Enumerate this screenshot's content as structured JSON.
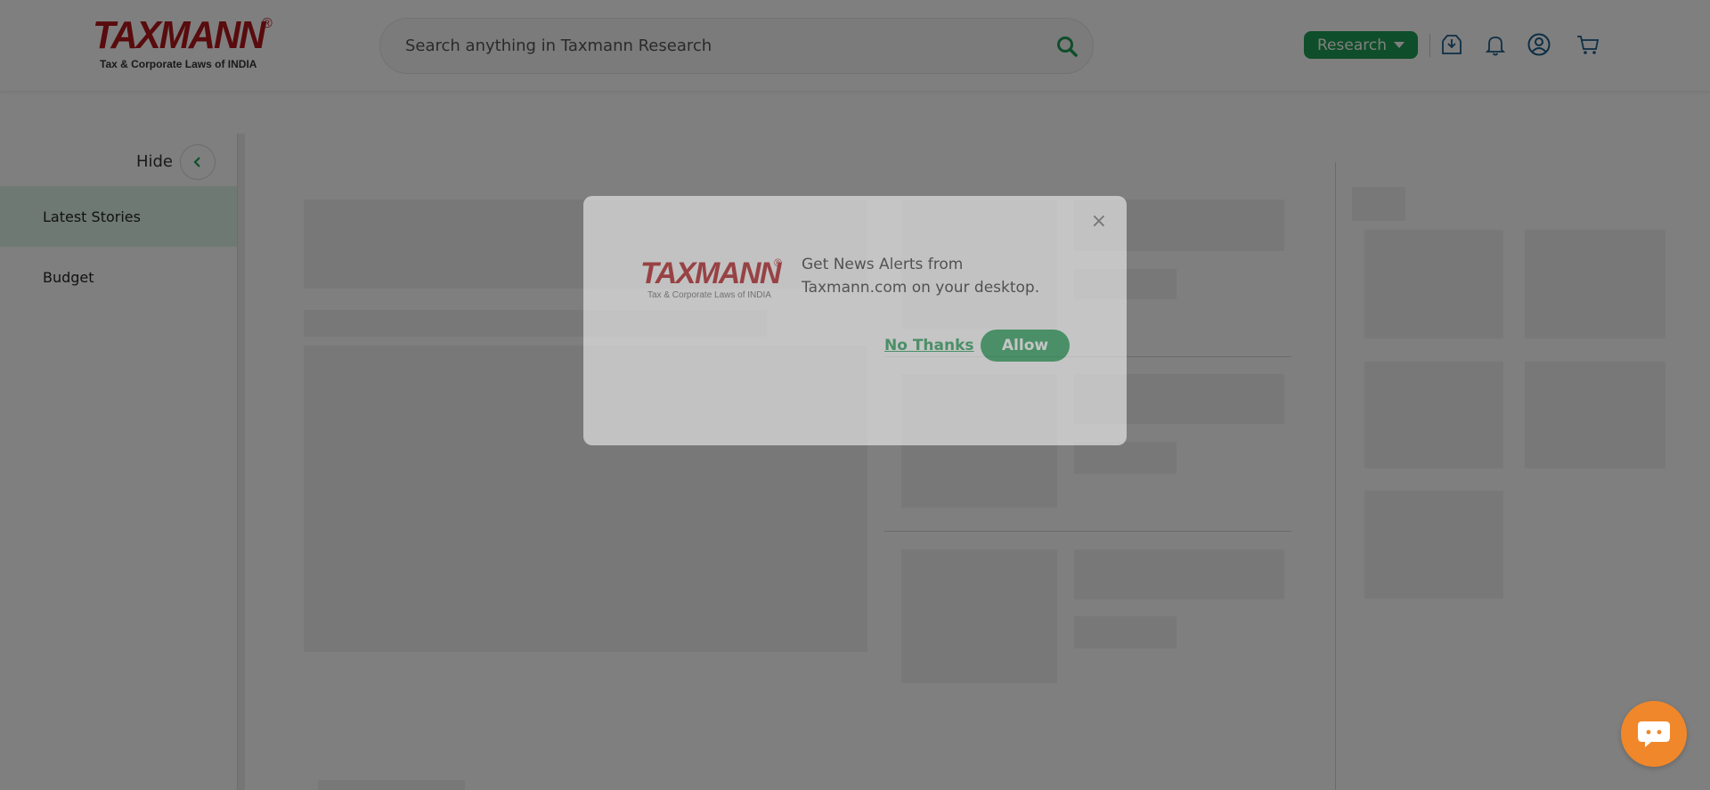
{
  "header": {
    "logo": {
      "word": "TAXMANN",
      "reg": "®",
      "tagline": "Tax & Corporate Laws of INDIA"
    },
    "search": {
      "placeholder": "Search anything in Taxmann Research",
      "icon": "search-icon"
    },
    "research_label": "Research",
    "icons": [
      "download-icon",
      "bell-icon",
      "user-icon",
      "cart-icon"
    ]
  },
  "sidebar": {
    "hide_label": "Hide",
    "items": [
      {
        "label": "Latest Stories",
        "active": true
      },
      {
        "label": "Budget",
        "active": false
      }
    ]
  },
  "modal": {
    "logo_word": "TAXMANN",
    "logo_reg": "®",
    "logo_tagline": "Tax & Corporate Laws of INDIA",
    "message": "Get News Alerts from Taxmann.com on your desktop.",
    "no_thanks_label": "No Thanks",
    "allow_label": "Allow",
    "close_glyph": "×"
  },
  "colors": {
    "brand_red": "#b3161b",
    "accent_green": "#1f9d55",
    "chat_orange": "#f0872a"
  }
}
